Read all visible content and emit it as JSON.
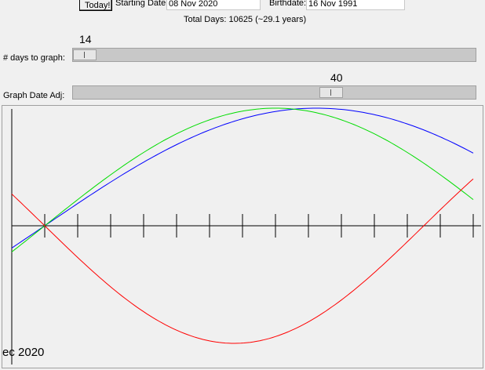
{
  "header": {
    "today_button": "Today!",
    "starting_date_label": "Starting Date:",
    "starting_date_value": "08 Nov 2020",
    "birthdate_label": "Birthdate:",
    "birthdate_value": "16 Nov 1991",
    "total_days": "Total Days: 10625 (~29.1 years)"
  },
  "days_slider": {
    "label": "# days to graph:",
    "value": "14",
    "fraction": 0.0
  },
  "adj_slider": {
    "label": "Graph Date Adj:",
    "value": "40",
    "fraction": 0.65
  },
  "graph": {
    "date_label": "ec 2020",
    "series_colors": {
      "red": "#ff0000",
      "green": "#00dd00",
      "blue": "#0000ff"
    },
    "tick_count": 14
  }
}
